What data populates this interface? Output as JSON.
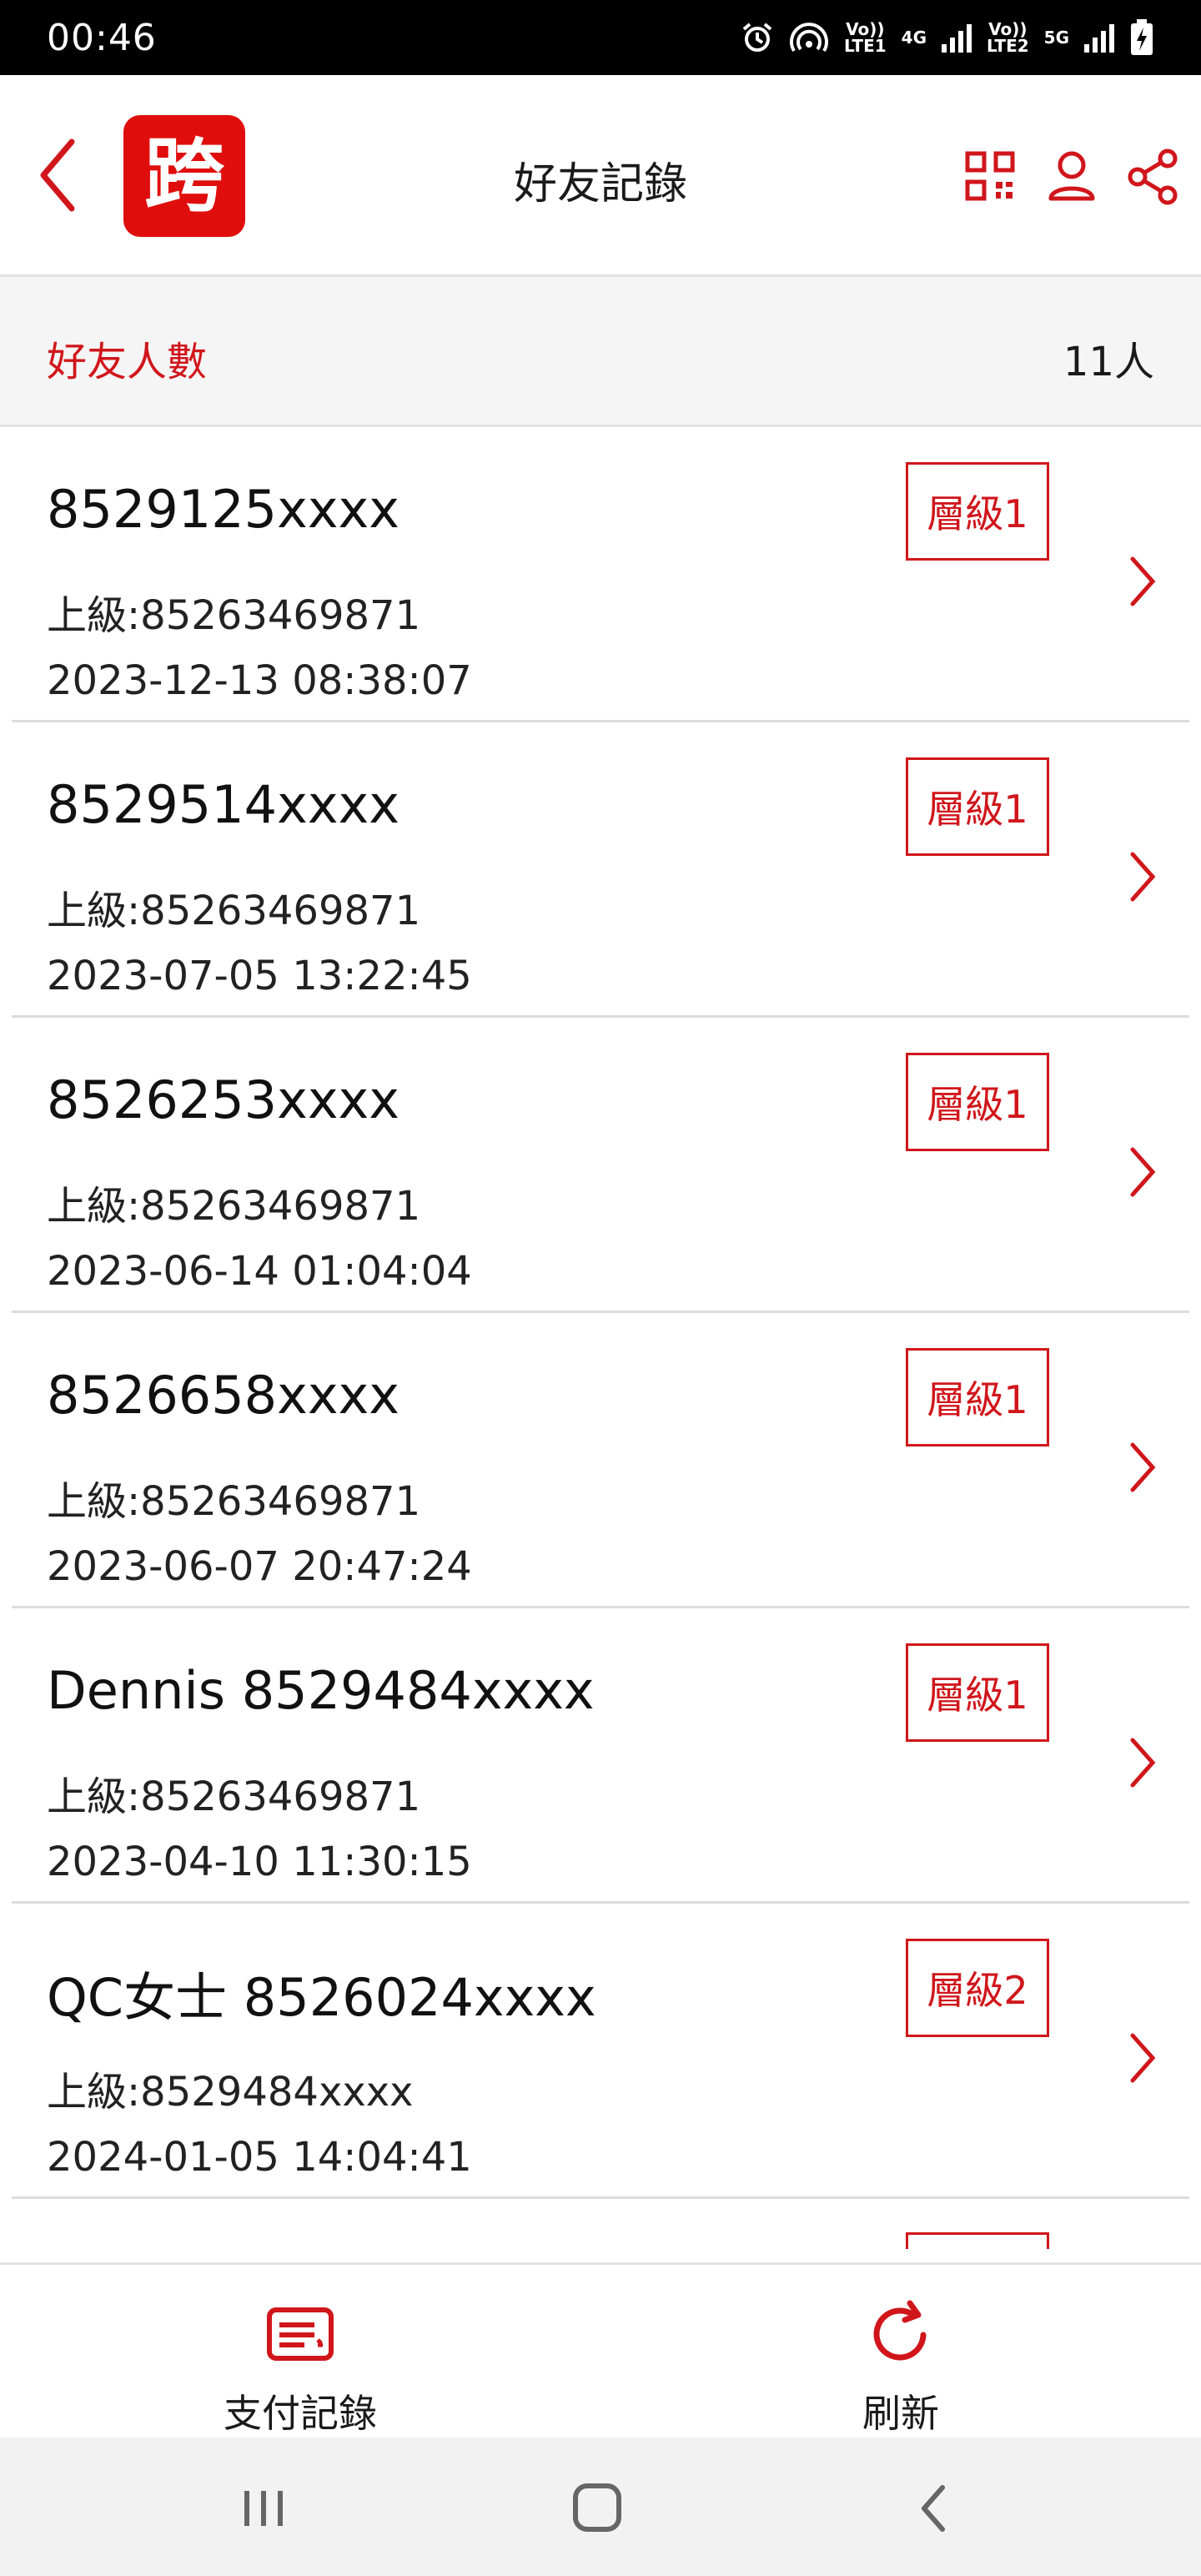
{
  "status_bar": {
    "time": "00:46",
    "sim1_label": "Vo))\nLTE1",
    "sim1_net": "4G",
    "sim2_label": "Vo))\nLTE2",
    "sim2_net": "5G"
  },
  "header": {
    "title": "好友記錄",
    "logo_glyph": "跨",
    "icons": [
      "back-arrow-icon",
      "qr-code-icon",
      "user-icon",
      "share-icon"
    ]
  },
  "summary": {
    "label": "好友人數",
    "value": "11人"
  },
  "friends": [
    {
      "name": "8529125xxxx",
      "parent": "上級:85263469871",
      "date": "2023-12-13 08:38:07",
      "level": "層級1"
    },
    {
      "name": "8529514xxxx",
      "parent": "上級:85263469871",
      "date": "2023-07-05 13:22:45",
      "level": "層級1"
    },
    {
      "name": "8526253xxxx",
      "parent": "上級:85263469871",
      "date": "2023-06-14 01:04:04",
      "level": "層級1"
    },
    {
      "name": "8526658xxxx",
      "parent": "上級:85263469871",
      "date": "2023-06-07 20:47:24",
      "level": "層級1"
    },
    {
      "name": "Dennis 8529484xxxx",
      "parent": "上級:85263469871",
      "date": "2023-04-10 11:30:15",
      "level": "層級1"
    },
    {
      "name": "QC女士 8526024xxxx",
      "parent": "上級:8529484xxxx",
      "date": "2024-01-05 14:04:41",
      "level": "層級2"
    }
  ],
  "bottom_tabs": [
    {
      "label": "支付記錄",
      "icon": "receipt-icon"
    },
    {
      "label": "刷新",
      "icon": "refresh-icon"
    }
  ],
  "colors": {
    "accent": "#d0161b",
    "logo_bg": "#e00d0d",
    "summary_bg": "#f5f5f5",
    "nav_bg": "#f2f2f2"
  }
}
